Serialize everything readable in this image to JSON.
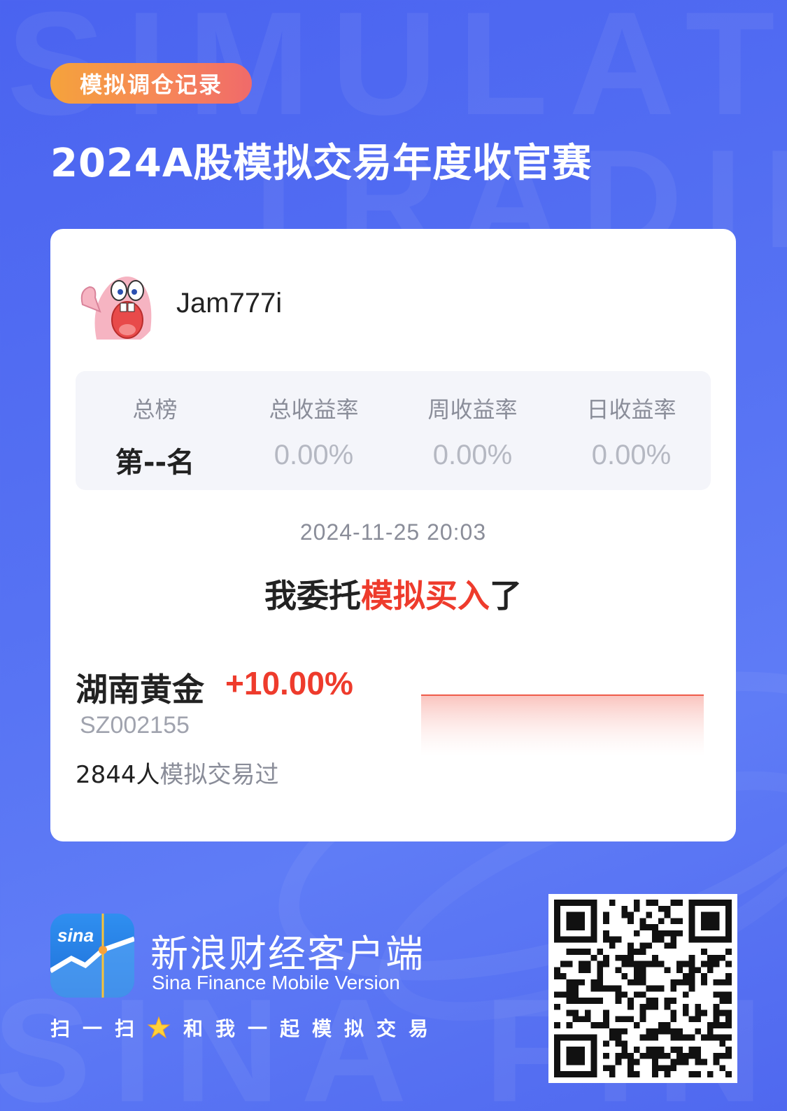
{
  "tag": {
    "label": "模拟调仓记录"
  },
  "headline": "2024A股模拟交易年度收官赛",
  "user": {
    "name": "Jam777i"
  },
  "stats": [
    {
      "label": "总榜",
      "value": "第--名"
    },
    {
      "label": "总收益率",
      "value": "0.00%"
    },
    {
      "label": "周收益率",
      "value": "0.00%"
    },
    {
      "label": "日收益率",
      "value": "0.00%"
    }
  ],
  "timestamp": "2024-11-25 20:03",
  "action": {
    "prefix": "我委托",
    "highlight": "模拟买入",
    "suffix": "了"
  },
  "stock": {
    "name": "湖南黄金",
    "change": "+10.00%",
    "code": "SZ002155",
    "traders_count": "2844人",
    "traders_suffix": "模拟交易过"
  },
  "footer": {
    "title": "新浪财经客户端",
    "subtitle": "Sina Finance Mobile Version",
    "cta_prefix": "扫一扫",
    "cta_suffix": "和我一起模拟交易"
  },
  "colors": {
    "accent_red": "#ee3b2c",
    "tag_gradient_start": "#f5a33c",
    "tag_gradient_end": "#f06a6a",
    "background": "#5672f3"
  },
  "icons": [
    "avatar-image",
    "sina-finance-logo",
    "star-icon",
    "qr-code"
  ]
}
